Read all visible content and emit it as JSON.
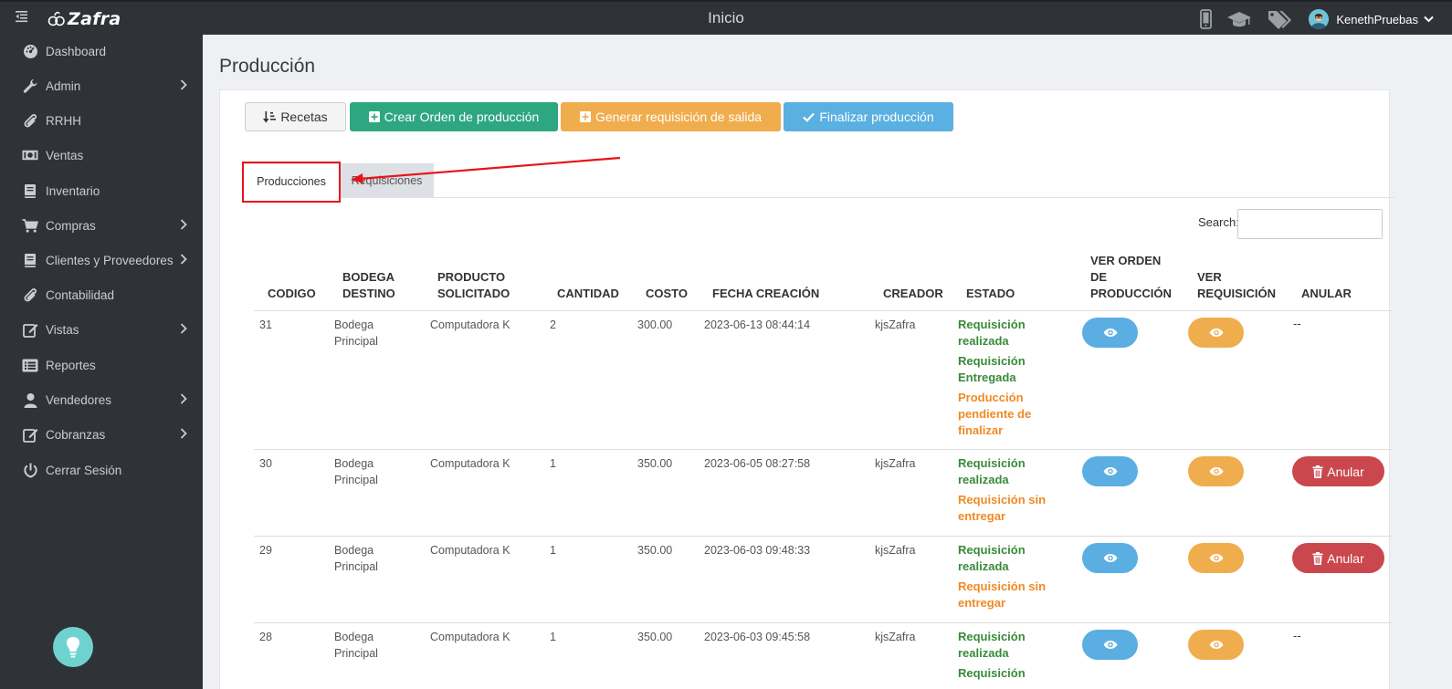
{
  "app": {
    "brand": "Zafra",
    "page_heading": "Inicio",
    "user_name": "KenethPruebas"
  },
  "sidebar": {
    "items": [
      {
        "label": "Dashboard",
        "icon": "dashboard-icon",
        "has_submenu": false
      },
      {
        "label": "Admin",
        "icon": "wrench-icon",
        "has_submenu": true
      },
      {
        "label": "RRHH",
        "icon": "paperclip-icon",
        "has_submenu": false
      },
      {
        "label": "Ventas",
        "icon": "money-icon",
        "has_submenu": false
      },
      {
        "label": "Inventario",
        "icon": "book-icon",
        "has_submenu": false
      },
      {
        "label": "Compras",
        "icon": "cart-icon",
        "has_submenu": true
      },
      {
        "label": "Clientes y Proveedores",
        "icon": "book-icon",
        "has_submenu": true
      },
      {
        "label": "Contabilidad",
        "icon": "paperclip-icon",
        "has_submenu": false
      },
      {
        "label": "Vistas",
        "icon": "edit-icon",
        "has_submenu": true
      },
      {
        "label": "Reportes",
        "icon": "list-icon",
        "has_submenu": false
      },
      {
        "label": "Vendedores",
        "icon": "user-icon",
        "has_submenu": true
      },
      {
        "label": "Cobranzas",
        "icon": "edit-icon",
        "has_submenu": true
      },
      {
        "label": "Cerrar Sesión",
        "icon": "power-icon",
        "has_submenu": false
      }
    ]
  },
  "main": {
    "title": "Producción",
    "buttons": {
      "recetas": "Recetas",
      "crear": "Crear Orden de producción",
      "generar": "Generar requisición de salida",
      "finalizar": "Finalizar producción"
    },
    "tabs": [
      {
        "label": "Producciones",
        "active": true
      },
      {
        "label": "Requisiciones",
        "active": false
      }
    ],
    "search_label": "Search:",
    "search_value": ""
  },
  "table": {
    "headers": {
      "codigo": "CODIGO",
      "bodega": [
        "BODEGA",
        "DESTINO"
      ],
      "producto": [
        "PRODUCTO",
        "SOLICITADO"
      ],
      "cantidad": "CANTIDAD",
      "costo": "COSTO",
      "fecha": "FECHA CREACIÓN",
      "creador": "CREADOR",
      "estado": "ESTADO",
      "ver_orden": [
        "VER ORDEN",
        "DE",
        "PRODUCCIÓN"
      ],
      "ver_req": [
        "VER",
        "REQUISICIÓN"
      ],
      "anular": "ANULAR"
    },
    "rows": [
      {
        "codigo": "31",
        "bodega": [
          "Bodega",
          "Principal"
        ],
        "producto": "Computadora K",
        "cantidad": "2",
        "costo": "300.00",
        "fecha": "2023-06-13 08:44:14",
        "creador": "kjsZafra",
        "estados": [
          {
            "lines": [
              "Requisición",
              "realizada"
            ],
            "color": "green"
          },
          {
            "lines": [
              "Requisición",
              "Entregada"
            ],
            "color": "green"
          },
          {
            "lines": [
              "Producción",
              "pendiente de",
              "finalizar"
            ],
            "color": "orange"
          }
        ],
        "anular": "--"
      },
      {
        "codigo": "30",
        "bodega": [
          "Bodega",
          "Principal"
        ],
        "producto": "Computadora K",
        "cantidad": "1",
        "costo": "350.00",
        "fecha": "2023-06-05 08:27:58",
        "creador": "kjsZafra",
        "estados": [
          {
            "lines": [
              "Requisición",
              "realizada"
            ],
            "color": "green"
          },
          {
            "lines": [
              "Requisición sin",
              "entregar"
            ],
            "color": "orange"
          }
        ],
        "anular": "Anular"
      },
      {
        "codigo": "29",
        "bodega": [
          "Bodega",
          "Principal"
        ],
        "producto": "Computadora K",
        "cantidad": "1",
        "costo": "350.00",
        "fecha": "2023-06-03 09:48:33",
        "creador": "kjsZafra",
        "estados": [
          {
            "lines": [
              "Requisición",
              "realizada"
            ],
            "color": "green"
          },
          {
            "lines": [
              "Requisición sin",
              "entregar"
            ],
            "color": "orange"
          }
        ],
        "anular": "Anular"
      },
      {
        "codigo": "28",
        "bodega": [
          "Bodega",
          "Principal"
        ],
        "producto": "Computadora K",
        "cantidad": "1",
        "costo": "350.00",
        "fecha": "2023-06-03 09:45:58",
        "creador": "kjsZafra",
        "estados": [
          {
            "lines": [
              "Requisición",
              "realizada"
            ],
            "color": "green"
          },
          {
            "lines": [
              "Requisición"
            ],
            "color": "green"
          }
        ],
        "anular": "--"
      }
    ]
  },
  "colors": {
    "sidebar_bg": "#2f3338",
    "crear_btn": "#2ea780",
    "generar_btn": "#f0ad4e",
    "finalizar_btn": "#5bb0e2",
    "anular_btn": "#c9474d",
    "status_green": "#3a8a3a",
    "status_orange": "#f08a24",
    "annotation_red": "#e8131a"
  }
}
